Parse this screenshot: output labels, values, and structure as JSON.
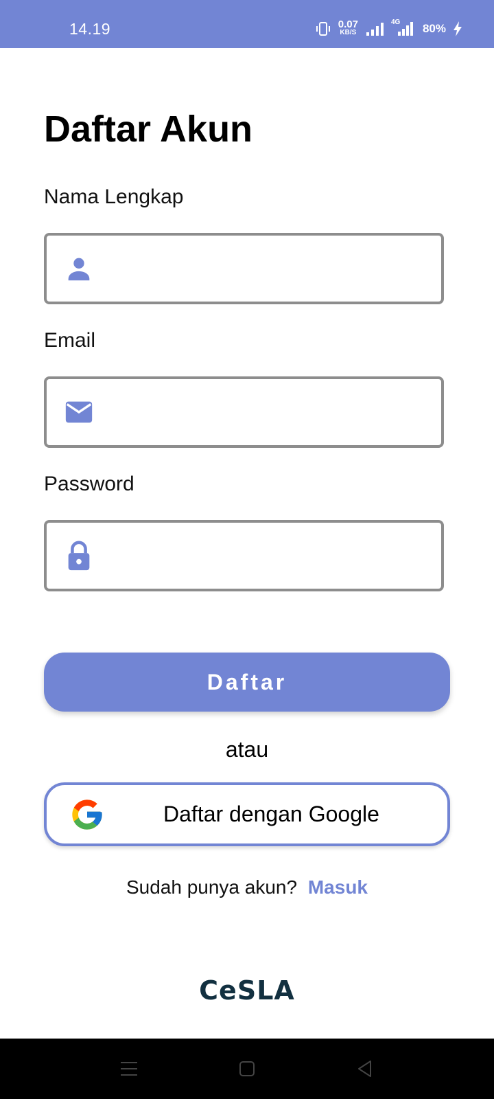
{
  "status_bar": {
    "time": "14.19",
    "speed_value": "0.07",
    "speed_unit": "KB/S",
    "network_type": "4G",
    "battery": "80%"
  },
  "page": {
    "title": "Daftar Akun"
  },
  "form": {
    "name_label": "Nama Lengkap",
    "name_value": "",
    "email_label": "Email",
    "email_value": "",
    "password_label": "Password",
    "password_value": ""
  },
  "actions": {
    "register_button": "Daftar",
    "or_text": "atau",
    "google_button": "Daftar dengan Google"
  },
  "login_prompt": {
    "text": "Sudah punya akun?",
    "link": "Masuk"
  },
  "brand": {
    "name": "CeSLA"
  },
  "icons": {
    "name_field": "person-icon",
    "email_field": "mail-icon",
    "password_field": "lock-icon",
    "google": "google-icon"
  },
  "colors": {
    "accent": "#7285d4",
    "field_border": "#8d8d8d",
    "brand_text": "#123040"
  }
}
